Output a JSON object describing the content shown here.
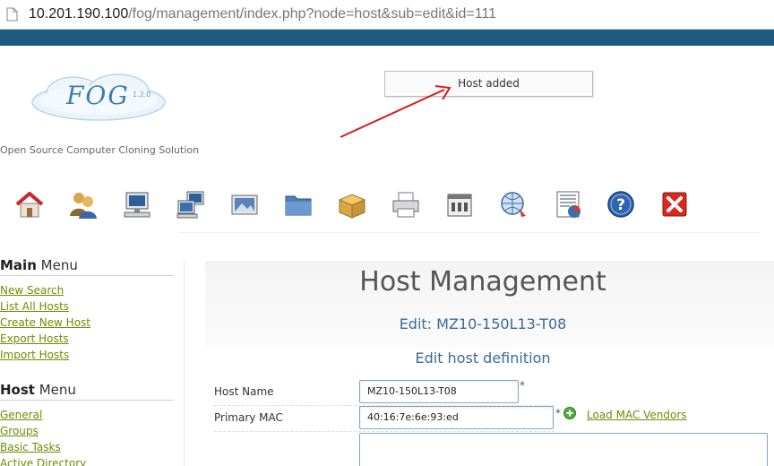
{
  "browser": {
    "url_host": "10.201.190.100",
    "url_rest": "/fog/management/index.php?node=host&sub=edit&id=111"
  },
  "header": {
    "logo_text": "FOG",
    "logo_version": "1.2.0",
    "tagline": "Open Source Computer Cloning Solution",
    "notice": "Host added"
  },
  "toolbar": {
    "icons": [
      "home-icon",
      "users-icon",
      "hosts-icon",
      "groups-icon",
      "images-icon",
      "storage-icon",
      "snapins-icon",
      "printers-icon",
      "services-icon",
      "tasks-icon",
      "reports-icon",
      "help-icon",
      "logout-icon"
    ]
  },
  "sidebar": {
    "main_menu": {
      "title_bold": "Main",
      "title_rest": " Menu",
      "items": [
        "New Search",
        "List All Hosts",
        "Create New Host",
        "Export Hosts",
        "Import Hosts"
      ]
    },
    "host_menu": {
      "title_bold": "Host",
      "title_rest": " Menu",
      "items": [
        "General",
        "Groups",
        "Basic Tasks",
        "Active Directory"
      ]
    }
  },
  "main": {
    "title": "Host Management",
    "subtitle": "Edit: MZ10-150L13-T08",
    "section": "Edit host definition",
    "form": {
      "host_name_label": "Host Name",
      "host_name_value": "MZ10-150L13-T08",
      "primary_mac_label": "Primary MAC",
      "primary_mac_value": "40:16:7e:6e:93:ed",
      "required_mark": "*",
      "load_mac_vendors": "Load MAC Vendors"
    }
  },
  "colors": {
    "top_band": "#1f5a80",
    "link": "#6b8e00",
    "heading_blue": "#3d6a92",
    "annotation_arrow": "#d81b1b"
  }
}
